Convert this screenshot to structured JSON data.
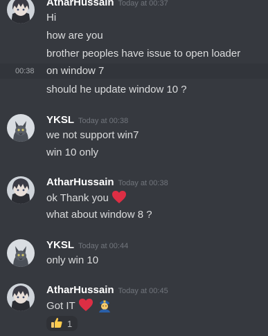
{
  "groups": [
    {
      "author": "AtharHussain",
      "timestamp": "Today at 00:37",
      "avatar": "anime-avatar",
      "messages": [
        "Hi",
        "how are you",
        "brother peoples have issue to open loader",
        "on window 7",
        "should he update window 10 ?"
      ],
      "hover_time": "00:38"
    },
    {
      "author": "YKSL",
      "timestamp": "Today at 00:38",
      "avatar": "cat-avatar",
      "messages": [
        "we not support win7",
        "win 10 only"
      ]
    },
    {
      "author": "AtharHussain",
      "timestamp": "Today at 00:38",
      "avatar": "anime-avatar",
      "messages": [
        "ok  Thank you",
        "what about window 8 ?"
      ],
      "message_emoji": "red-heart-icon"
    },
    {
      "author": "YKSL",
      "timestamp": "Today at 00:44",
      "avatar": "cat-avatar",
      "messages": [
        "only win 10"
      ]
    },
    {
      "author": "AtharHussain",
      "timestamp": "Today at 00:45",
      "avatar": "anime-avatar",
      "messages": [
        "Got IT"
      ],
      "message_emoji": [
        "red-heart-icon",
        "police-officer-icon"
      ],
      "reaction": {
        "emoji": "thumbs-up-icon",
        "count": "1"
      }
    }
  ],
  "colors": {
    "background": "#36393f",
    "author": "#ffffff",
    "timestamp": "#72767d",
    "message_text": "#dcddde",
    "heart": "#dd2e44"
  }
}
